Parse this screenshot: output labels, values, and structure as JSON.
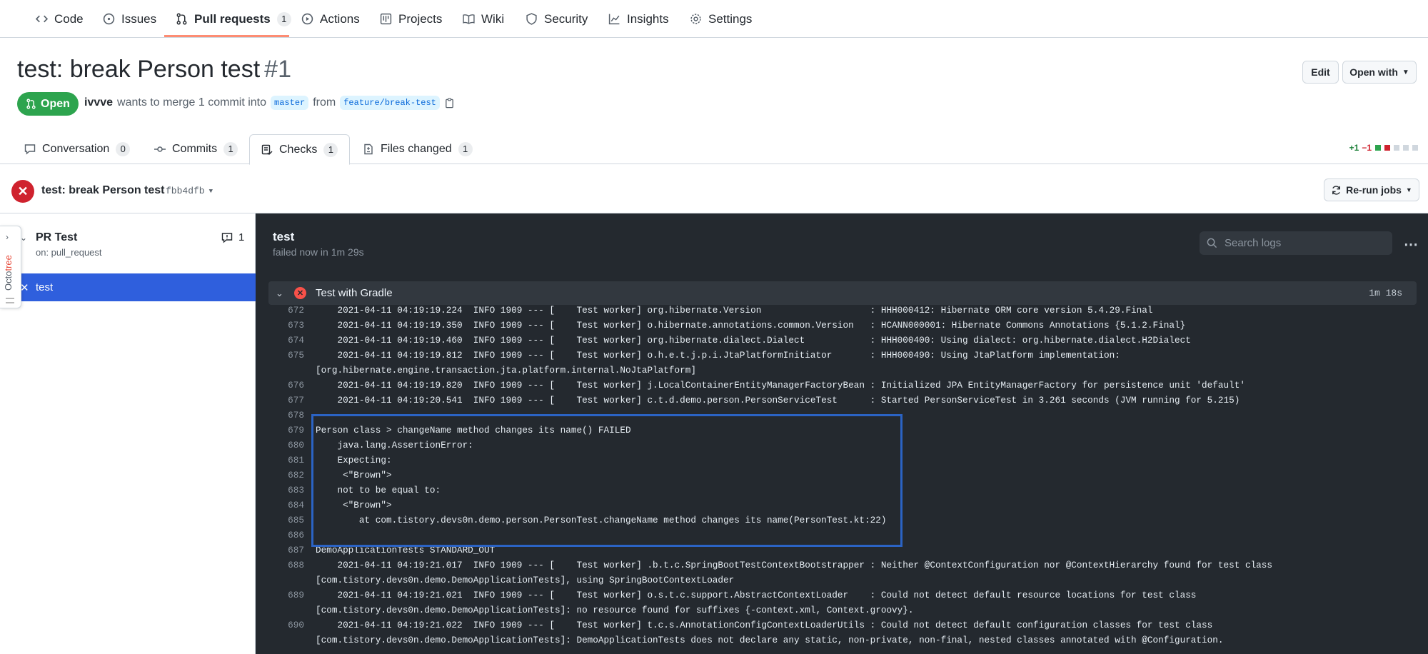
{
  "repo_nav": {
    "items": [
      {
        "label": "Code",
        "icon": "code-icon"
      },
      {
        "label": "Issues",
        "icon": "issue-icon"
      },
      {
        "label": "Pull requests",
        "icon": "pull-request-icon",
        "count": "1"
      },
      {
        "label": "Actions",
        "icon": "play-icon"
      },
      {
        "label": "Projects",
        "icon": "project-icon"
      },
      {
        "label": "Wiki",
        "icon": "book-icon"
      },
      {
        "label": "Security",
        "icon": "shield-icon"
      },
      {
        "label": "Insights",
        "icon": "graph-icon"
      },
      {
        "label": "Settings",
        "icon": "gear-icon"
      }
    ],
    "active": "Pull requests"
  },
  "pr": {
    "title": "test: break Person test",
    "number": "#1",
    "state": "Open",
    "author": "ivvve",
    "merge_text": "wants to merge 1 commit into",
    "base_branch": "master",
    "from_text": "from",
    "head_branch": "feature/break-test",
    "edit_label": "Edit",
    "open_with_label": "Open with"
  },
  "pr_tabs": [
    {
      "label": "Conversation",
      "count": "0",
      "icon": "comment-icon"
    },
    {
      "label": "Commits",
      "count": "1",
      "icon": "commit-icon"
    },
    {
      "label": "Checks",
      "count": "1",
      "icon": "checklist-icon"
    },
    {
      "label": "Files changed",
      "count": "1",
      "icon": "file-diff-icon"
    }
  ],
  "active_tab": "Checks",
  "diffstat": {
    "additions": "+1",
    "deletions": "−1"
  },
  "check": {
    "title": "test: break Person test",
    "sha": "fbb4dfb",
    "rerun_label": "Re-run jobs"
  },
  "sidebar": {
    "workflow_name": "PR Test",
    "workflow_trigger": "on: pull_request",
    "comment_count": "1",
    "job_name": "test",
    "octotree": {
      "prefix": "Octo",
      "suffix": "tree"
    }
  },
  "job": {
    "name": "test",
    "status": "failed now in 1m 29s",
    "search_placeholder": "Search logs",
    "step_name": "Test with Gradle",
    "step_duration": "1m 18s"
  },
  "log_lines": [
    {
      "n": "672",
      "text": "    2021-04-11 04:19:19.224  INFO 1909 --- [    Test worker] org.hibernate.Version                    : HHH000412: Hibernate ORM core version 5.4.29.Final"
    },
    {
      "n": "673",
      "text": "    2021-04-11 04:19:19.350  INFO 1909 --- [    Test worker] o.hibernate.annotations.common.Version   : HCANN000001: Hibernate Commons Annotations {5.1.2.Final}"
    },
    {
      "n": "674",
      "text": "    2021-04-11 04:19:19.460  INFO 1909 --- [    Test worker] org.hibernate.dialect.Dialect            : HHH000400: Using dialect: org.hibernate.dialect.H2Dialect"
    },
    {
      "n": "675",
      "text": "    2021-04-11 04:19:19.812  INFO 1909 --- [    Test worker] o.h.e.t.j.p.i.JtaPlatformInitiator       : HHH000490: Using JtaPlatform implementation:"
    },
    {
      "n": "",
      "text": "[org.hibernate.engine.transaction.jta.platform.internal.NoJtaPlatform]"
    },
    {
      "n": "676",
      "text": "    2021-04-11 04:19:19.820  INFO 1909 --- [    Test worker] j.LocalContainerEntityManagerFactoryBean : Initialized JPA EntityManagerFactory for persistence unit 'default'"
    },
    {
      "n": "677",
      "text": "    2021-04-11 04:19:20.541  INFO 1909 --- [    Test worker] c.t.d.demo.person.PersonServiceTest      : Started PersonServiceTest in 3.261 seconds (JVM running for 5.215)"
    },
    {
      "n": "678",
      "text": ""
    },
    {
      "n": "679",
      "text": "Person class > changeName method changes its name() FAILED"
    },
    {
      "n": "680",
      "text": "    java.lang.AssertionError:"
    },
    {
      "n": "681",
      "text": "    Expecting:"
    },
    {
      "n": "682",
      "text": "     <\"Brown\">"
    },
    {
      "n": "683",
      "text": "    not to be equal to:"
    },
    {
      "n": "684",
      "text": "     <\"Brown\">"
    },
    {
      "n": "685",
      "text": "        at com.tistory.devs0n.demo.person.PersonTest.changeName method changes its name(PersonTest.kt:22)"
    },
    {
      "n": "686",
      "text": ""
    },
    {
      "n": "687",
      "text": "DemoApplicationTests STANDARD_OUT"
    },
    {
      "n": "688",
      "text": "    2021-04-11 04:19:21.017  INFO 1909 --- [    Test worker] .b.t.c.SpringBootTestContextBootstrapper : Neither @ContextConfiguration nor @ContextHierarchy found for test class"
    },
    {
      "n": "",
      "text": "[com.tistory.devs0n.demo.DemoApplicationTests], using SpringBootContextLoader"
    },
    {
      "n": "689",
      "text": "    2021-04-11 04:19:21.021  INFO 1909 --- [    Test worker] o.s.t.c.support.AbstractContextLoader    : Could not detect default resource locations for test class"
    },
    {
      "n": "",
      "text": "[com.tistory.devs0n.demo.DemoApplicationTests]: no resource found for suffixes {-context.xml, Context.groovy}."
    },
    {
      "n": "690",
      "text": "    2021-04-11 04:19:21.022  INFO 1909 --- [    Test worker] t.c.s.AnnotationConfigContextLoaderUtils : Could not detect default configuration classes for test class"
    },
    {
      "n": "",
      "text": "[com.tistory.devs0n.demo.DemoApplicationTests]: DemoApplicationTests does not declare any static, non-private, non-final, nested classes annotated with @Configuration."
    }
  ]
}
